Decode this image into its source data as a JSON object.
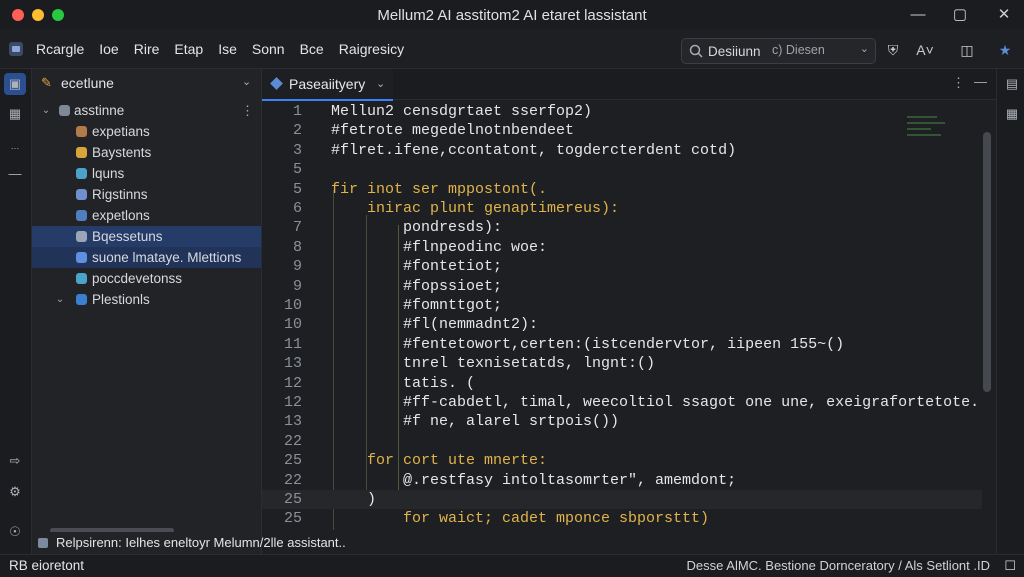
{
  "window": {
    "title": "Mellum2 AI asstitom2 AI etaret lassistant",
    "controls": [
      "—",
      "▢",
      "✕"
    ]
  },
  "menubar": {
    "items": [
      "Rcargle",
      "Ioe",
      "Rire",
      "Etap",
      "Ise",
      "Sonn",
      "Bce",
      "Raigresicy"
    ],
    "search": {
      "value": "Desiiunn",
      "hint": "c) Diesen"
    }
  },
  "sidebar": {
    "title": "ecetlune",
    "tree": [
      {
        "label": "asstinne",
        "depth": 0,
        "expanded": true,
        "icon_color": "#7f8896"
      },
      {
        "label": "expetians",
        "depth": 1,
        "icon_color": "#b07a4a"
      },
      {
        "label": "Baystents",
        "depth": 1,
        "icon_color": "#d9a43a"
      },
      {
        "label": "lquns",
        "depth": 1,
        "icon_color": "#4aa3c8"
      },
      {
        "label": "Rigstinns",
        "depth": 1,
        "icon_color": "#6f8fd0"
      },
      {
        "label": "expetlons",
        "depth": 1,
        "icon_color": "#4f7fc0"
      },
      {
        "label": "Bqessetuns",
        "depth": 1,
        "icon_color": "#9aa6b8",
        "selected": true
      },
      {
        "label": "suone lmataye. Mlettions",
        "depth": 1,
        "icon_color": "#5f8fe0",
        "selected2": true
      },
      {
        "label": "poccdevetonss",
        "depth": 1,
        "icon_color": "#4aa3c8"
      },
      {
        "label": "Plestionls",
        "depth": 1,
        "expanded": true,
        "icon_color": "#3a7fd0"
      }
    ]
  },
  "editor": {
    "tab": {
      "label": "Paseaiityery"
    },
    "lines": [
      {
        "num": "1",
        "text": "Mellun2 censdgrtaet sserfop2)"
      },
      {
        "num": "2",
        "text": "#fetrote megedelnotnbendeet"
      },
      {
        "num": "3",
        "text": "#flret.ifene,ccontatont, togdercterdent cotd)"
      },
      {
        "num": "5",
        "text": ""
      },
      {
        "num": "5",
        "text": "fir inot ser mppostont(."
      },
      {
        "num": "6",
        "text": "    inirac plunt genaptimereus):"
      },
      {
        "num": "7",
        "text": "        pondresds):"
      },
      {
        "num": "8",
        "text": "        #flnpeodinc woe:"
      },
      {
        "num": "9",
        "text": "        #fontetiot;"
      },
      {
        "num": "9",
        "text": "        #fopssioet;"
      },
      {
        "num": "10",
        "text": "        #fomnttgot;"
      },
      {
        "num": "10",
        "text": "        #fl(nemmadnt2):"
      },
      {
        "num": "11",
        "text": "        #fentetowort,certen:(istcendervtor, iipeen 155~()"
      },
      {
        "num": "13",
        "text": "        tnrel texnisetatds, lngnt:()"
      },
      {
        "num": "12",
        "text": "        tatis. ("
      },
      {
        "num": "12",
        "text": "        #ff-cabdetl, timal, weecoltiol ssagot one une, exeigrafortetote."
      },
      {
        "num": "13",
        "text": "        #f ne, alarel srtpois())"
      },
      {
        "num": "22",
        "text": ""
      },
      {
        "num": "25",
        "text": "    for cort ute mnerte:"
      },
      {
        "num": "22",
        "text": "        @.restfasy intoltasomrter\", amemdont;"
      },
      {
        "num": "25",
        "text": "    )"
      },
      {
        "num": "25",
        "text": "        for waict; cadet mponce sbporsttt)"
      }
    ],
    "current_line_index": 20
  },
  "panel": {
    "text": "Relpsirenn: Ielhes eneltoyr Melumn/2lle assistant.."
  },
  "status": {
    "left": "RB eioretont",
    "right": "Desse AlMC. Bestione Dornceratory / Als Setliont .ID"
  },
  "colors": {
    "accent": "#3b82f6",
    "selection": "#253b68",
    "keyword": "#e0b44b"
  }
}
